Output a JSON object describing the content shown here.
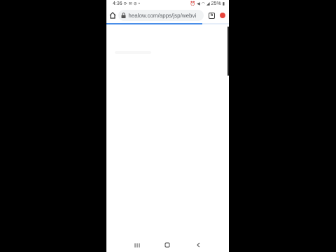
{
  "status_bar": {
    "time": "4:36",
    "battery": "25%",
    "left_icons": [
      "sync-icon",
      "message-icon",
      "notification-icon",
      "dot-icon"
    ],
    "right_icons": [
      "alarm-icon",
      "mute-icon",
      "wifi-icon",
      "signal-icon",
      "battery-icon"
    ]
  },
  "browser": {
    "url": "healow.com/apps/jsp/webvi",
    "tab_count": "5",
    "load_progress": 0.78
  },
  "nav": {
    "buttons": [
      "recents-icon",
      "home-icon",
      "back-icon"
    ]
  },
  "colors": {
    "accent_progress": "#4a8ee8",
    "menu_badge": "#e8453c"
  }
}
